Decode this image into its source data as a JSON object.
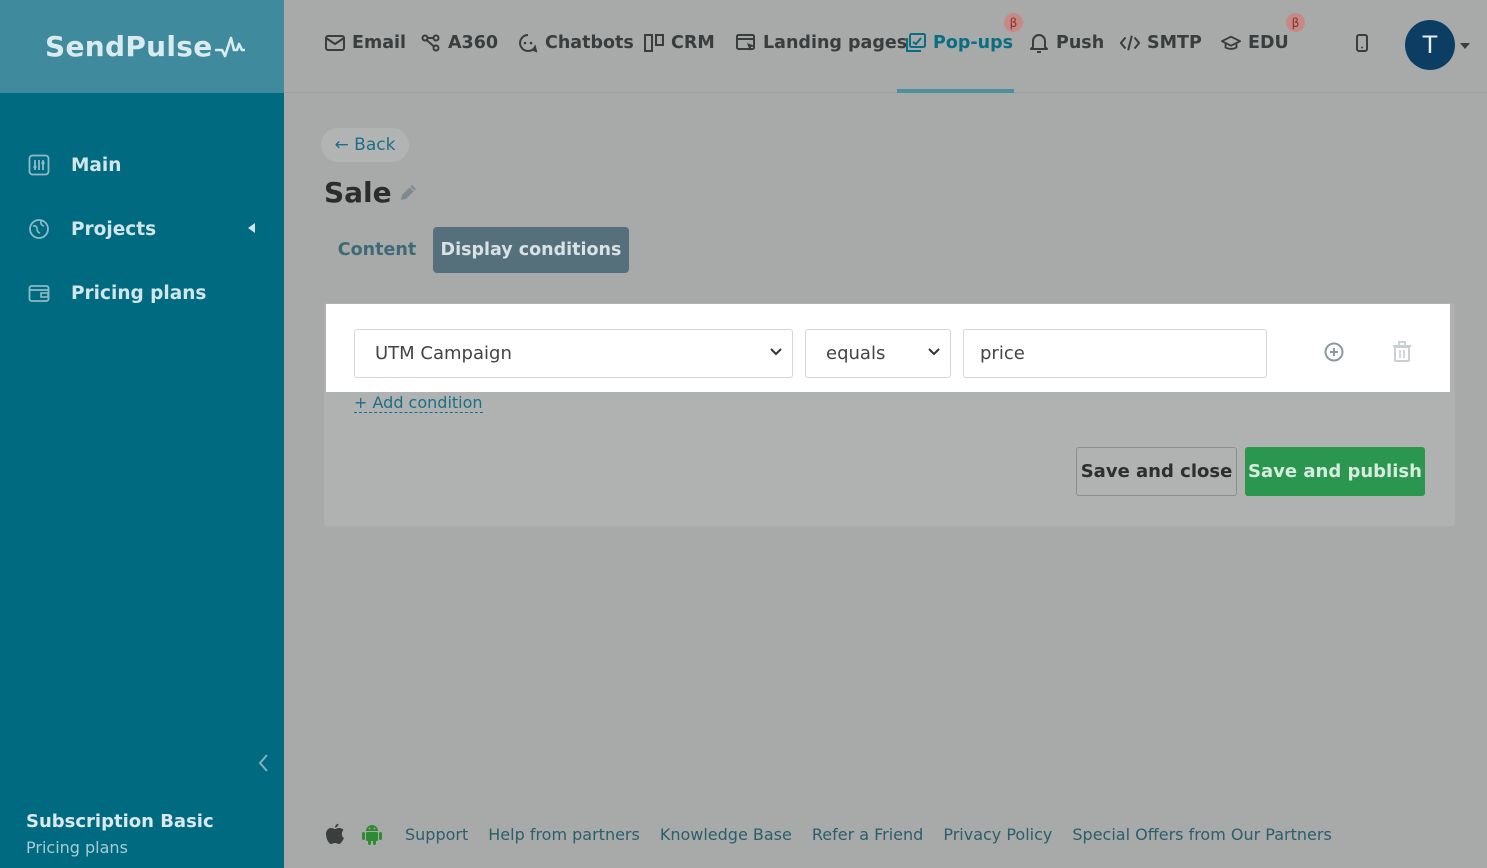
{
  "brand": {
    "logo_text": "SendPulse"
  },
  "sidebar": {
    "items": [
      {
        "label": "Main",
        "icon": "dashboard-icon"
      },
      {
        "label": "Projects",
        "icon": "globe-icon"
      },
      {
        "label": "Pricing plans",
        "icon": "wallet-icon"
      }
    ],
    "subscription_title": "Subscription Basic",
    "subscription_link": "Pricing plans"
  },
  "topnav": {
    "items": [
      {
        "label": "Email",
        "icon": "mail-icon"
      },
      {
        "label": "A360",
        "icon": "flow-icon"
      },
      {
        "label": "Chatbots",
        "icon": "chat-icon"
      },
      {
        "label": "CRM",
        "icon": "kanban-icon"
      },
      {
        "label": "Landing pages",
        "icon": "landing-icon"
      },
      {
        "label": "Pop-ups",
        "icon": "popup-icon",
        "active": true,
        "beta": "β"
      },
      {
        "label": "Push",
        "icon": "bell-icon"
      },
      {
        "label": "SMTP",
        "icon": "code-icon"
      },
      {
        "label": "EDU",
        "icon": "graduation-cap-icon",
        "beta": "β"
      }
    ],
    "avatar_initial": "T"
  },
  "page": {
    "back_label": "← Back",
    "title": "Sale",
    "tabs": [
      {
        "label": "Content",
        "active": false
      },
      {
        "label": "Display conditions",
        "active": true
      }
    ]
  },
  "condition": {
    "field_value": "UTM Campaign",
    "operator_value": "equals",
    "value": "price",
    "add_label": "+ Add condition"
  },
  "actions": {
    "save_close_label": "Save and close",
    "save_publish_label": "Save and publish"
  },
  "footer": {
    "links": [
      "Support",
      "Help from partners",
      "Knowledge Base",
      "Refer a Friend",
      "Privacy Policy",
      "Special Offers from Our Partners"
    ]
  },
  "colors": {
    "sidebar": "#006a80",
    "accent": "#0a6e83",
    "publish": "#2a9650",
    "overlay": "#a8a9a9"
  }
}
